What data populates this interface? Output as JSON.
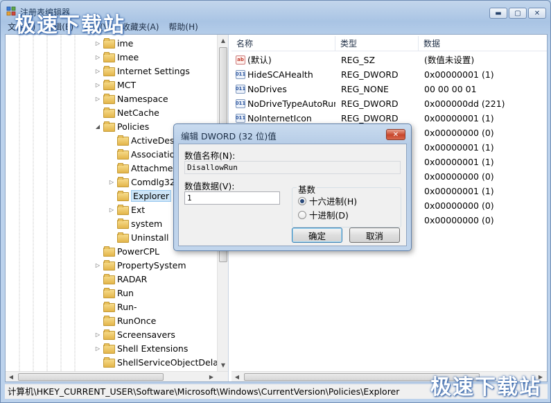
{
  "window": {
    "title": "注册表编辑器",
    "watermark": "极速下载站"
  },
  "menu": [
    "文件(F)",
    "编辑(E)",
    "查看(V)",
    "收藏夹(A)",
    "帮助(H)"
  ],
  "tree": {
    "items": [
      {
        "label": "ime",
        "expander": "▷",
        "indent": 0
      },
      {
        "label": "Imee",
        "expander": "▷",
        "indent": 0
      },
      {
        "label": "Internet Settings",
        "expander": "▷",
        "indent": 0
      },
      {
        "label": "MCT",
        "expander": "▷",
        "indent": 0
      },
      {
        "label": "Namespace",
        "expander": "▷",
        "indent": 0
      },
      {
        "label": "NetCache",
        "expander": "",
        "indent": 0
      },
      {
        "label": "Policies",
        "expander": "◢",
        "indent": 0
      },
      {
        "label": "ActiveDesk",
        "expander": "",
        "indent": 1
      },
      {
        "label": "Associations",
        "expander": "",
        "indent": 1
      },
      {
        "label": "Attachments",
        "expander": "",
        "indent": 1
      },
      {
        "label": "Comdlg32",
        "expander": "▷",
        "indent": 1
      },
      {
        "label": "Explorer",
        "expander": "",
        "indent": 1,
        "selected": true
      },
      {
        "label": "Ext",
        "expander": "▷",
        "indent": 1
      },
      {
        "label": "system",
        "expander": "",
        "indent": 1
      },
      {
        "label": "Uninstall",
        "expander": "",
        "indent": 1
      },
      {
        "label": "PowerCPL",
        "expander": "",
        "indent": 0
      },
      {
        "label": "PropertySystem",
        "expander": "▷",
        "indent": 0
      },
      {
        "label": "RADAR",
        "expander": "",
        "indent": 0
      },
      {
        "label": "Run",
        "expander": "",
        "indent": 0
      },
      {
        "label": "Run-",
        "expander": "",
        "indent": 0
      },
      {
        "label": "RunOnce",
        "expander": "",
        "indent": 0
      },
      {
        "label": "Screensavers",
        "expander": "▷",
        "indent": 0
      },
      {
        "label": "Shell Extensions",
        "expander": "▷",
        "indent": 0
      },
      {
        "label": "ShellServiceObjectDelayLoad",
        "expander": "",
        "indent": 0
      }
    ]
  },
  "list": {
    "columns": {
      "name": "名称",
      "type": "类型",
      "data": "数据"
    },
    "rows": [
      {
        "icon": "ab",
        "name": "(默认)",
        "type": "REG_SZ",
        "data": "(数值未设置)"
      },
      {
        "icon": "bin",
        "name": "HideSCAHealth",
        "type": "REG_DWORD",
        "data": "0x00000001 (1)"
      },
      {
        "icon": "bin",
        "name": "NoDrives",
        "type": "REG_NONE",
        "data": "00 00 00 01"
      },
      {
        "icon": "bin",
        "name": "NoDriveTypeAutoRun",
        "type": "REG_DWORD",
        "data": "0x000000dd (221)"
      },
      {
        "icon": "bin",
        "name": "NoInternetIcon",
        "type": "REG_DWORD",
        "data": "0x00000001 (1)"
      },
      {
        "icon": "",
        "name": "",
        "type": "",
        "data": "0x00000000 (0)"
      },
      {
        "icon": "",
        "name": "",
        "type": "",
        "data": "0x00000001 (1)"
      },
      {
        "icon": "",
        "name": "",
        "type": "",
        "data": "0x00000001 (1)"
      },
      {
        "icon": "",
        "name": "",
        "type": "",
        "data": "0x00000000 (0)"
      },
      {
        "icon": "",
        "name": "",
        "type": "",
        "data": "0x00000001 (1)"
      },
      {
        "icon": "",
        "name": "",
        "type": "",
        "data": "0x00000000 (0)"
      },
      {
        "icon": "",
        "name": "",
        "type": "",
        "data": "0x00000000 (0)"
      }
    ]
  },
  "statusbar": "计算机\\HKEY_CURRENT_USER\\Software\\Microsoft\\Windows\\CurrentVersion\\Policies\\Explorer",
  "dialog": {
    "title": "编辑 DWORD (32 位)值",
    "close": "✕",
    "name_label": "数值名称(N):",
    "name_value": "DisallowRun",
    "data_label": "数值数据(V):",
    "data_value": "1",
    "base_label": "基数",
    "hex_label": "十六进制(H)",
    "dec_label": "十进制(D)",
    "ok": "确定",
    "cancel": "取消"
  }
}
